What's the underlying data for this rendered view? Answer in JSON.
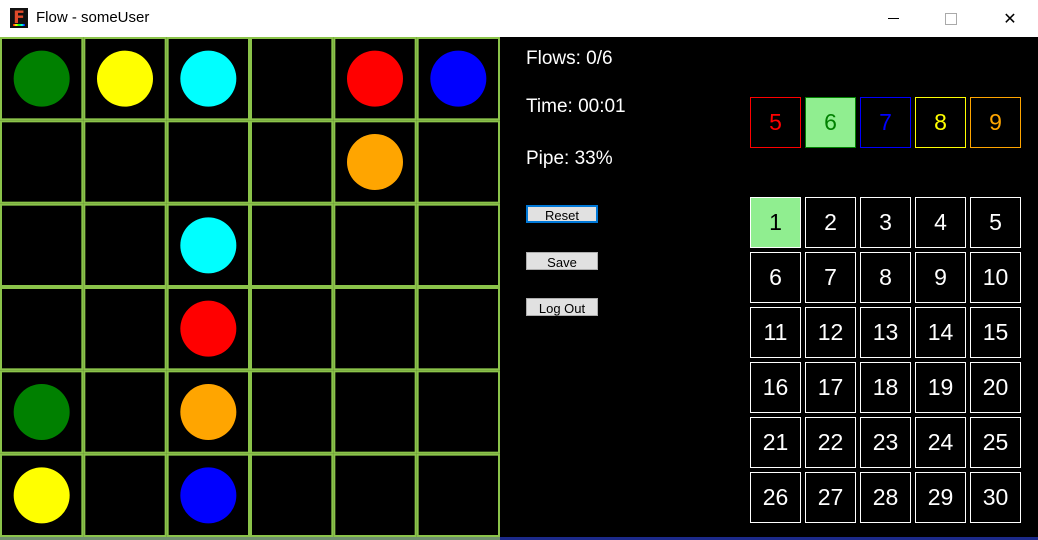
{
  "window": {
    "title": "Flow - someUser",
    "icon": "app-f-icon",
    "controls": [
      "minimize-icon",
      "maximize-icon",
      "close-icon"
    ],
    "close_glyph": "✕"
  },
  "board": {
    "rows": 6,
    "cols": 6,
    "grid_color": "#8bc34a",
    "dots": [
      {
        "row": 0,
        "col": 0,
        "color": "#008000",
        "name": "green"
      },
      {
        "row": 0,
        "col": 1,
        "color": "#ffff00",
        "name": "yellow"
      },
      {
        "row": 0,
        "col": 2,
        "color": "#00ffff",
        "name": "cyan"
      },
      {
        "row": 0,
        "col": 4,
        "color": "#ff0000",
        "name": "red"
      },
      {
        "row": 0,
        "col": 5,
        "color": "#0000ff",
        "name": "blue"
      },
      {
        "row": 1,
        "col": 4,
        "color": "#ffa500",
        "name": "orange"
      },
      {
        "row": 2,
        "col": 2,
        "color": "#00ffff",
        "name": "cyan"
      },
      {
        "row": 3,
        "col": 2,
        "color": "#ff0000",
        "name": "red"
      },
      {
        "row": 4,
        "col": 0,
        "color": "#008000",
        "name": "green"
      },
      {
        "row": 4,
        "col": 2,
        "color": "#ffa500",
        "name": "orange"
      },
      {
        "row": 5,
        "col": 0,
        "color": "#ffff00",
        "name": "yellow"
      },
      {
        "row": 5,
        "col": 2,
        "color": "#0000ff",
        "name": "blue"
      }
    ]
  },
  "stats": {
    "flows": "Flows: 0/6",
    "time": "Time: 00:01",
    "pipe": "Pipe: 33%"
  },
  "buttons": {
    "reset": "Reset",
    "save": "Save",
    "logout": "Log Out"
  },
  "sizes": [
    {
      "label": "5",
      "color": "#ff0000",
      "selected": false
    },
    {
      "label": "6",
      "color": "#008000",
      "selected": true
    },
    {
      "label": "7",
      "color": "#0000ff",
      "selected": false
    },
    {
      "label": "8",
      "color": "#ffff00",
      "selected": false
    },
    {
      "label": "9",
      "color": "#ffa500",
      "selected": false
    }
  ],
  "levels": [
    "1",
    "2",
    "3",
    "4",
    "5",
    "6",
    "7",
    "8",
    "9",
    "10",
    "11",
    "12",
    "13",
    "14",
    "15",
    "16",
    "17",
    "18",
    "19",
    "20",
    "21",
    "22",
    "23",
    "24",
    "25",
    "26",
    "27",
    "28",
    "29",
    "30"
  ],
  "selected_level": "1",
  "colors": {
    "selected_bg": "#90ee90",
    "focus_border": "#0078d7"
  }
}
